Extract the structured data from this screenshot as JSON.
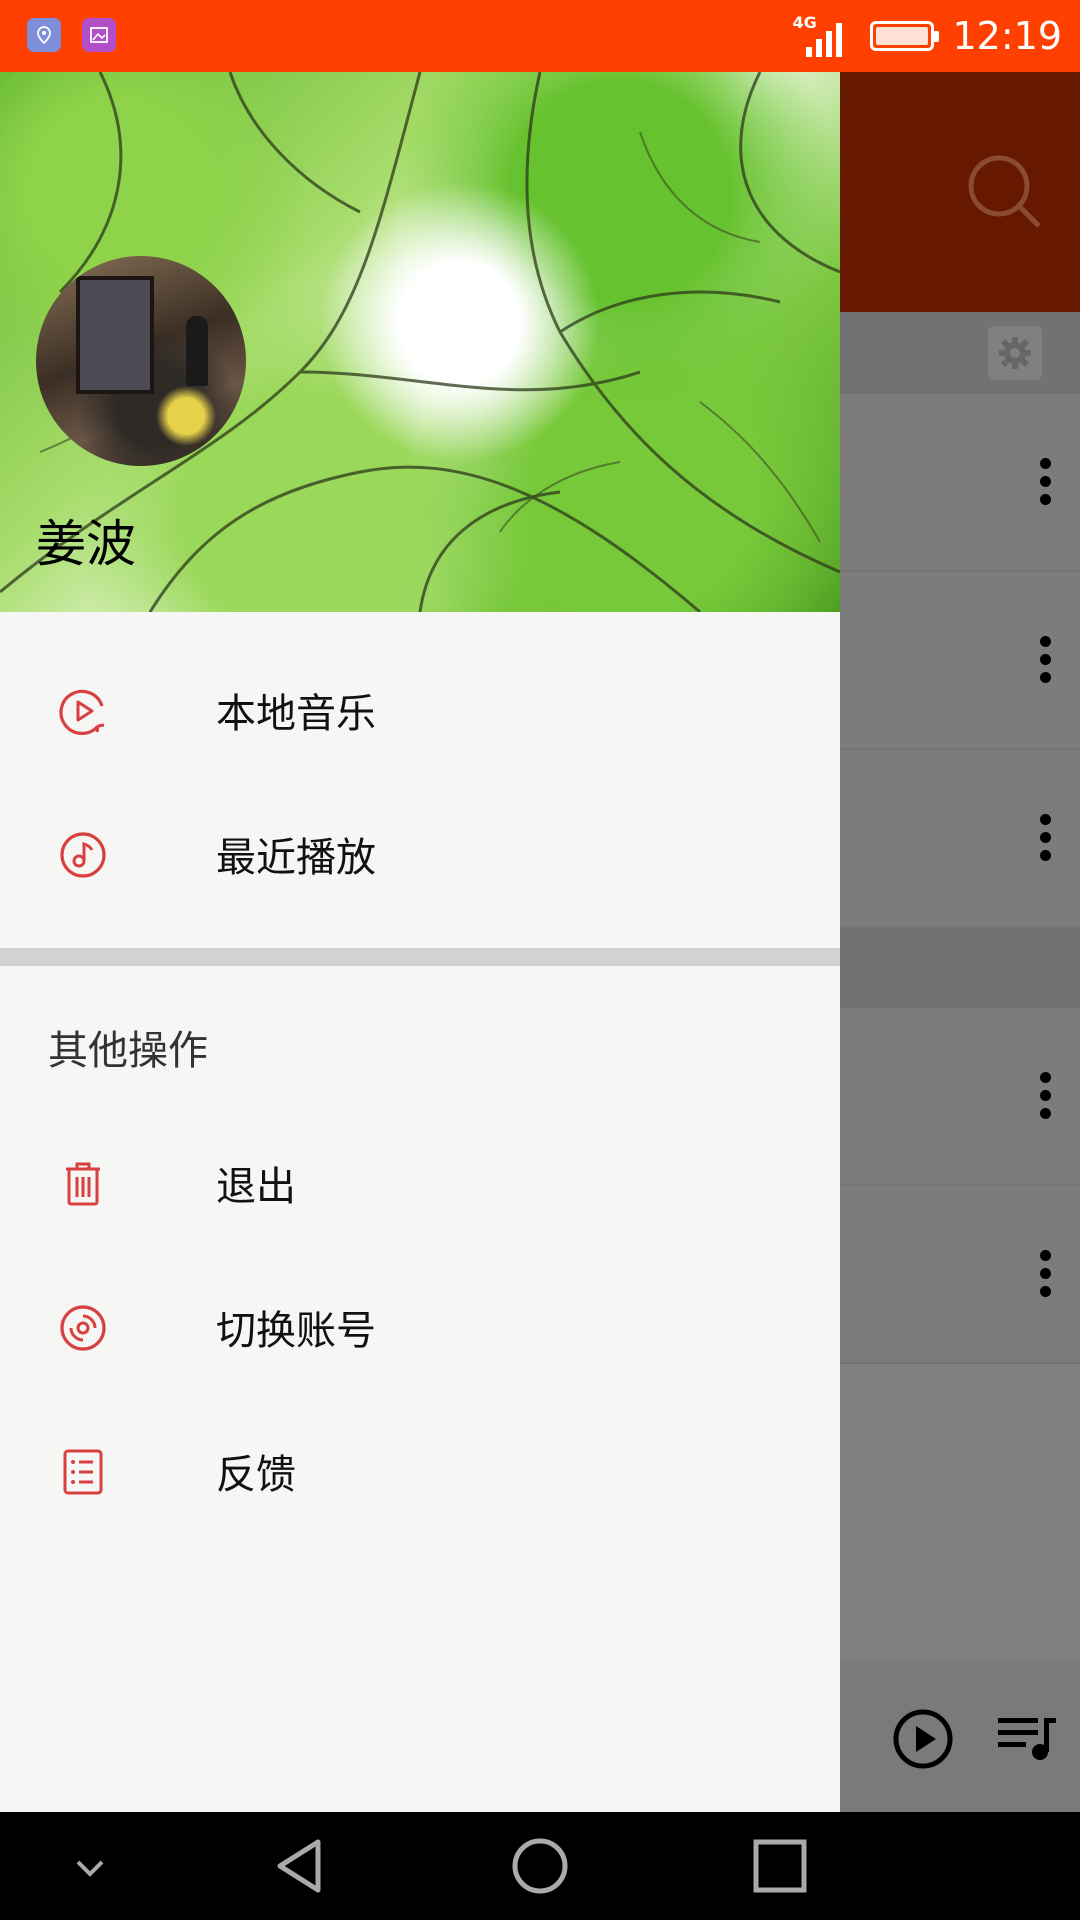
{
  "status_bar": {
    "network": "4G",
    "time": "12:19",
    "left_icons": [
      "location-app-icon",
      "gallery-app-icon"
    ]
  },
  "drawer": {
    "user": {
      "name": "姜波"
    },
    "primary_items": [
      {
        "label": "本地音乐",
        "icon": "play-circle-icon"
      },
      {
        "label": "最近播放",
        "icon": "music-note-circle-icon"
      }
    ],
    "other_section_title": "其他操作",
    "other_items": [
      {
        "label": "退出",
        "icon": "trash-icon"
      },
      {
        "label": "切换账号",
        "icon": "disc-icon"
      },
      {
        "label": "反馈",
        "icon": "list-icon"
      }
    ]
  },
  "background_app": {
    "toolbar_icons": [
      "search-icon",
      "settings-gear-icon"
    ],
    "row_count": 5,
    "player_icons": [
      "play-icon",
      "playlist-icon"
    ]
  },
  "colors": {
    "status_bar": "#ff4000",
    "accent": "#d84040",
    "drawer_bg": "#f6f6f4",
    "scrim_bg": "#808080"
  }
}
